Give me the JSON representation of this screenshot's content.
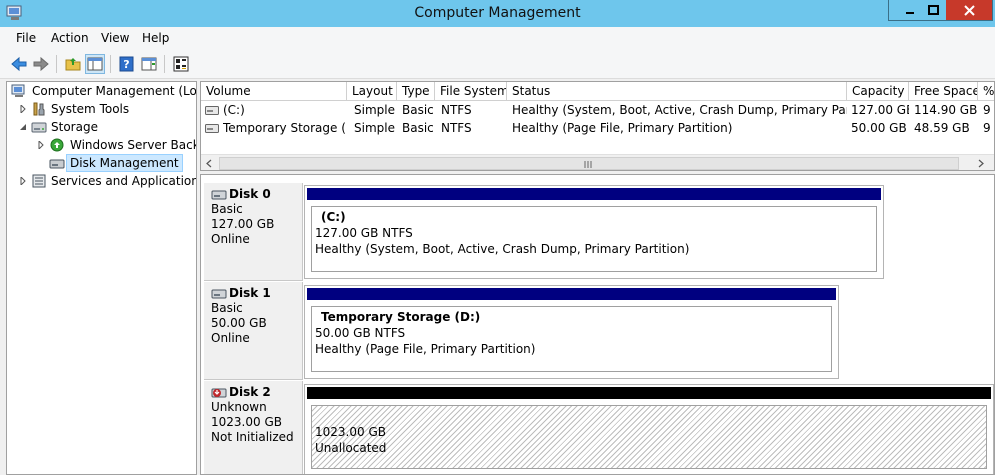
{
  "window": {
    "title": "Computer Management"
  },
  "menu": [
    "File",
    "Action",
    "View",
    "Help"
  ],
  "tree": {
    "root": "Computer Management (Local)",
    "items": [
      {
        "label": "System Tools"
      },
      {
        "label": "Storage"
      },
      {
        "label": "Windows Server Backup"
      },
      {
        "label": "Disk Management"
      },
      {
        "label": "Services and Applications"
      }
    ]
  },
  "volumes": {
    "columns": [
      "Volume",
      "Layout",
      "Type",
      "File System",
      "Status",
      "Capacity",
      "Free Space",
      "%"
    ],
    "rows": [
      {
        "volume": "(C:)",
        "layout": "Simple",
        "type": "Basic",
        "fs": "NTFS",
        "status": "Healthy (System, Boot, Active, Crash Dump, Primary Partition)",
        "capacity": "127.00 GB",
        "free": "114.90 GB",
        "pct": "9"
      },
      {
        "volume": "Temporary Storage (D:)",
        "layout": "Simple",
        "type": "Basic",
        "fs": "NTFS",
        "status": "Healthy (Page File, Primary Partition)",
        "capacity": "50.00 GB",
        "free": "48.59 GB",
        "pct": "9"
      }
    ]
  },
  "disks": [
    {
      "name": "Disk 0",
      "kind": "Basic",
      "size": "127.00 GB",
      "state": "Online",
      "partition": {
        "title": "(C:)",
        "size": "127.00 GB NTFS",
        "status": "Healthy (System, Boot, Active, Crash Dump, Primary Partition)"
      }
    },
    {
      "name": "Disk 1",
      "kind": "Basic",
      "size": "50.00 GB",
      "state": "Online",
      "partition": {
        "title": "Temporary Storage  (D:)",
        "size": "50.00 GB NTFS",
        "status": "Healthy (Page File, Primary Partition)"
      }
    },
    {
      "name": "Disk 2",
      "kind": "Unknown",
      "size": "1023.00 GB",
      "state": "Not Initialized",
      "partition": {
        "size": "1023.00 GB",
        "status": "Unallocated"
      }
    }
  ],
  "colors": {
    "primary_bar": "#000080",
    "unallocated_bar": "#000000",
    "titlebar": "#6ec6ec",
    "close": "#c7392a"
  }
}
